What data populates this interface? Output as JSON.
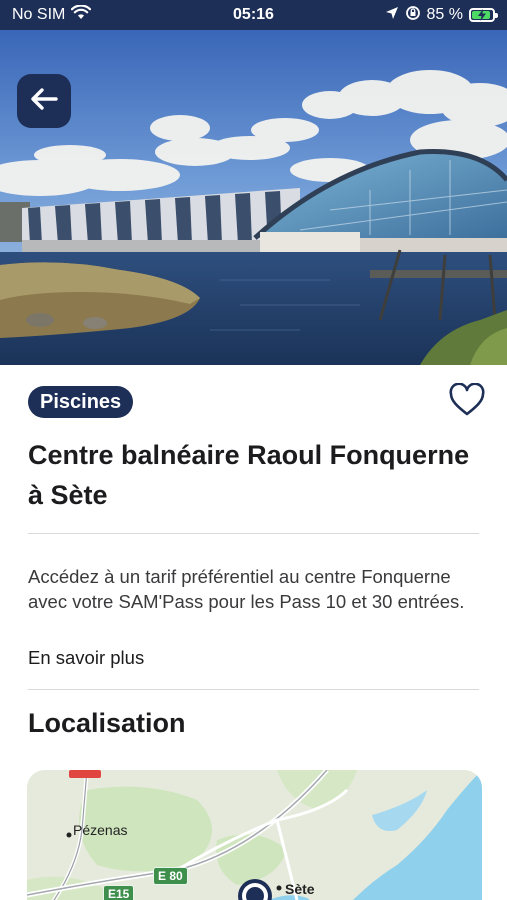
{
  "status_bar": {
    "carrier": "No SIM",
    "time": "05:16",
    "battery_percent": "85 %",
    "battery_level": 0.85
  },
  "hero": {
    "back_label": "",
    "photo_subject": "Centre balnéaire building by the water"
  },
  "place": {
    "category": "Piscines",
    "title": "Centre balnéaire Raoul Fonquerne à Sète",
    "description": "Accédez à un tarif préférentiel  au centre Fonquerne avec votre SAM'Pass pour les Pass 10 et 30 entrées.",
    "more_link": "En savoir plus"
  },
  "location": {
    "section_title": "Localisation",
    "map_labels": {
      "town_1": "Pézenas",
      "town_2": "Sète",
      "road_1": "E 80",
      "road_2": "E15"
    }
  },
  "colors": {
    "brand_navy": "#1e2f57",
    "sea": "#8fd0ec",
    "land": "#e6eadc",
    "green_area": "#cfe5bd"
  }
}
